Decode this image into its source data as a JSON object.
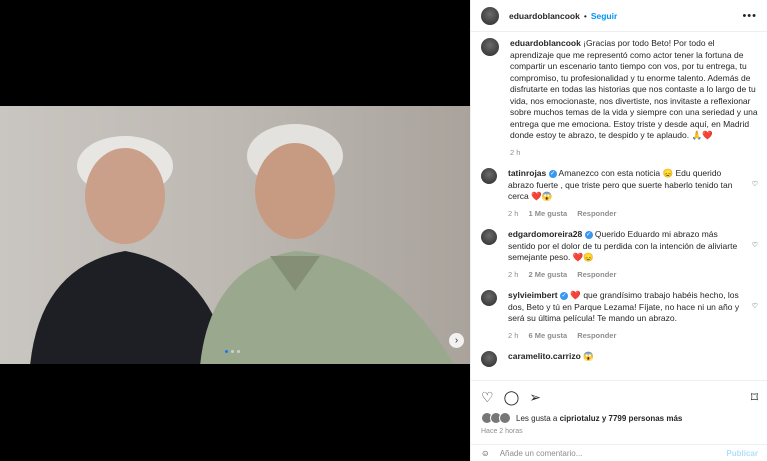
{
  "post": {
    "author": "eduardoblancook",
    "follow_label": "Seguir",
    "more": "•••",
    "caption": "¡Gracias por todo Beto! Por todo el aprendizaje que me representó como actor tener la fortuna de compartir un escenario tanto tiempo con vos, por tu entrega, tu compromiso, tu profesionalidad y tu enorme talento. Además de disfrutarte en todas las historias que nos contaste a lo largo de tu vida, nos emocionaste, nos divertiste, nos invitaste a reflexionar sobre muchos temas de la vida y siempre con una seriedad y una entrega que me emociona. Estoy triste y desde aquí, en Madrid donde estoy te abrazo, te despido y te aplaudo. 🙏❤️",
    "caption_time": "2 h"
  },
  "comments": [
    {
      "user": "tatinrojas",
      "verified": true,
      "text": "Amanezco con esta noticia 😞 Edu querido abrazo fuerte , que triste pero que suerte haberlo tenido tan cerca ❤️😱",
      "time": "2 h",
      "likes": "1 Me gusta",
      "reply": "Responder"
    },
    {
      "user": "edgardomoreira28",
      "verified": true,
      "text": "Querido Eduardo mi abrazo más sentido por el dolor de tu perdida con la intención de aliviarte semejante peso. ❤️😞",
      "time": "2 h",
      "likes": "2 Me gusta",
      "reply": "Responder"
    },
    {
      "user": "sylvieimbert",
      "verified": true,
      "text": "❤️ que grandísimo trabajo habéis hecho, los dos, Beto y tú en Parque Lezama! Fíjate, no hace ni un año y será su última película! Te mando un abrazo.",
      "time": "2 h",
      "likes": "6 Me gusta",
      "reply": "Responder"
    },
    {
      "user": "caramelito.carrizo",
      "verified": false,
      "text": "😱",
      "time": "",
      "likes": "",
      "reply": ""
    }
  ],
  "likes": {
    "prefix": "Les gusta a",
    "user": "cipriotaluz",
    "suffix": "y 7799 personas más"
  },
  "time_ago": "Hace 2 horas",
  "add_comment": {
    "placeholder": "Añade un comentario...",
    "publish": "Publicar"
  },
  "icons": {
    "like": "heart-icon",
    "comment": "comment-icon",
    "share": "share-icon",
    "save": "bookmark-icon",
    "emoji": "emoji-icon",
    "next": "chevron-right-icon"
  }
}
